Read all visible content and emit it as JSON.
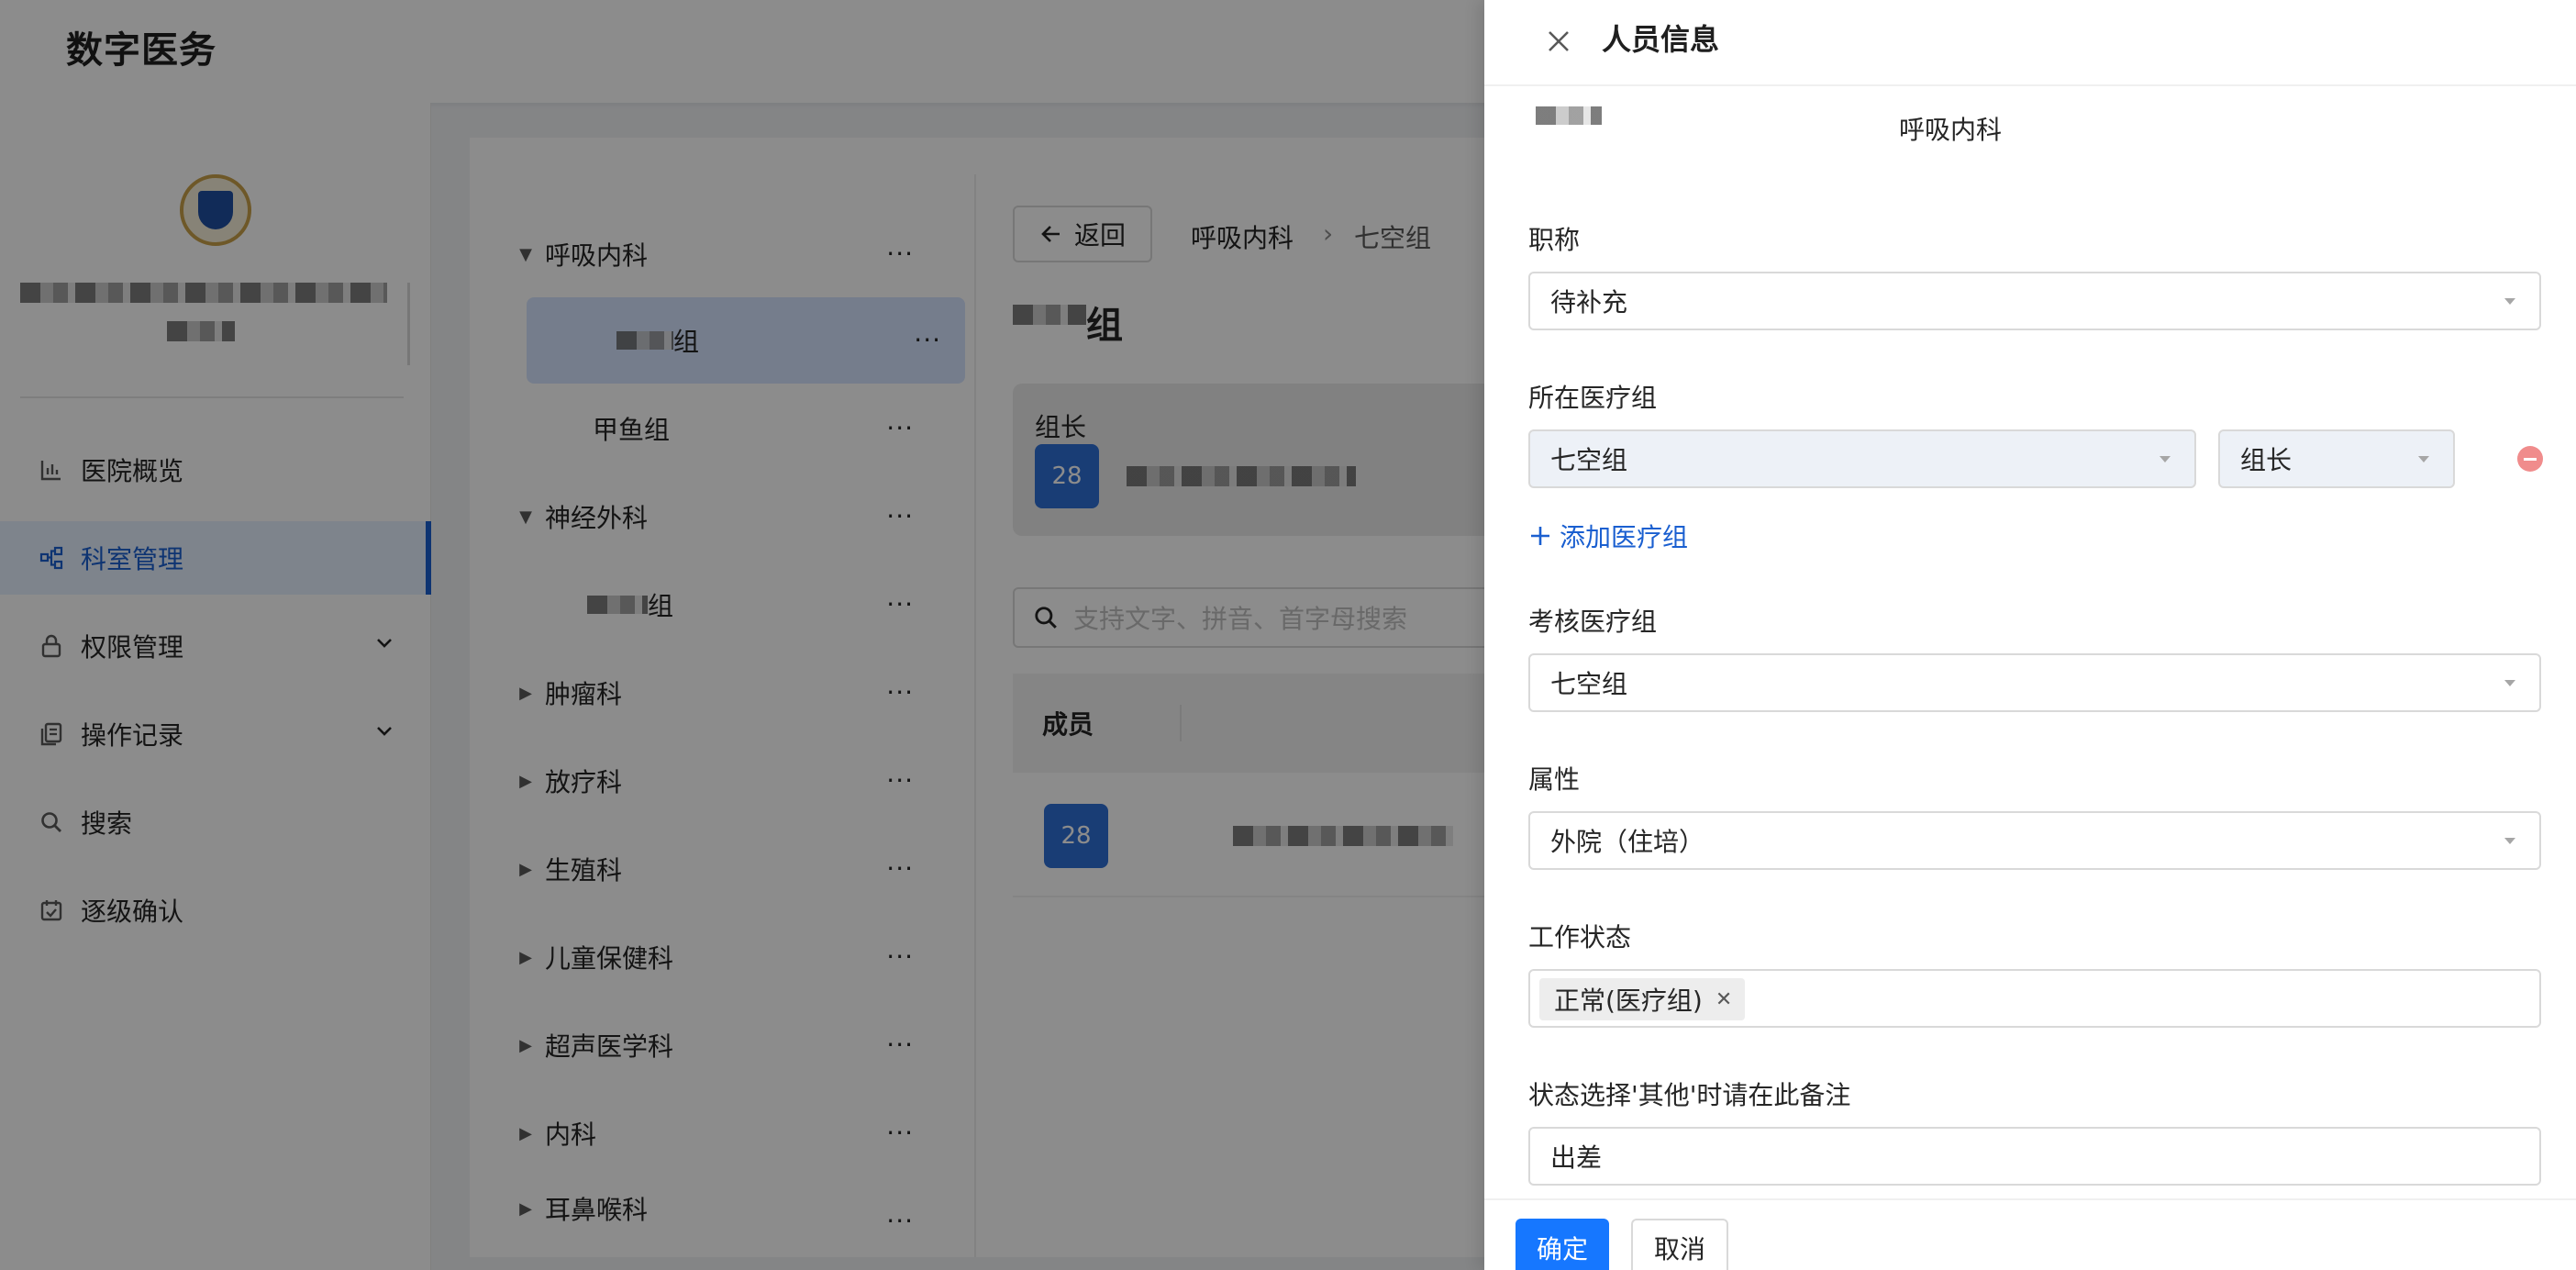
{
  "app": {
    "title": "数字医务"
  },
  "sidebar": {
    "items": [
      {
        "label": "医院概览",
        "icon": "bar-chart-icon"
      },
      {
        "label": "科室管理",
        "icon": "org-tree-icon",
        "active": true
      },
      {
        "label": "权限管理",
        "icon": "lock-icon",
        "expandable": true
      },
      {
        "label": "操作记录",
        "icon": "record-icon",
        "expandable": true
      },
      {
        "label": "搜索",
        "icon": "search-icon"
      },
      {
        "label": "逐级确认",
        "icon": "calendar-check-icon"
      }
    ]
  },
  "tree": {
    "items": [
      {
        "label": "呼吸内科",
        "expanded": true
      },
      {
        "label": "组",
        "selected": true
      },
      {
        "label": "甲鱼组"
      },
      {
        "label": "神经外科",
        "expanded": true
      },
      {
        "label": "组"
      },
      {
        "label": "肿瘤科"
      },
      {
        "label": "放疗科"
      },
      {
        "label": "生殖科"
      },
      {
        "label": "儿童保健科"
      },
      {
        "label": "超声医学科"
      },
      {
        "label": "内科"
      },
      {
        "label": "耳鼻喉科"
      }
    ]
  },
  "main": {
    "back_label": "返回",
    "breadcrumb": [
      "呼吸内科",
      "七空组"
    ],
    "group_title": "组",
    "leader_label": "组长",
    "badge": "28",
    "search_placeholder": "支持文字、拼音、首字母搜索",
    "table_header": "成员",
    "row_badge": "28"
  },
  "drawer": {
    "title": "人员信息",
    "department_value": "呼吸内科",
    "fields": {
      "title_label": "职称",
      "title_value": "待补充",
      "group_label": "所在医疗组",
      "group_value": "七空组",
      "role_value": "组长",
      "add_group": "添加医疗组",
      "exam_group_label": "考核医疗组",
      "exam_group_value": "七空组",
      "attr_label": "属性",
      "attr_value": "外院（住培）",
      "status_label": "工作状态",
      "status_tag": "正常(医疗组)",
      "remark_label": "状态选择'其他'时请在此备注",
      "remark_value": "出差"
    },
    "confirm": "确定",
    "cancel": "取消"
  },
  "colors": {
    "primary": "#1677ff",
    "accent": "#1a5fd0",
    "danger": "#f08c8c"
  }
}
